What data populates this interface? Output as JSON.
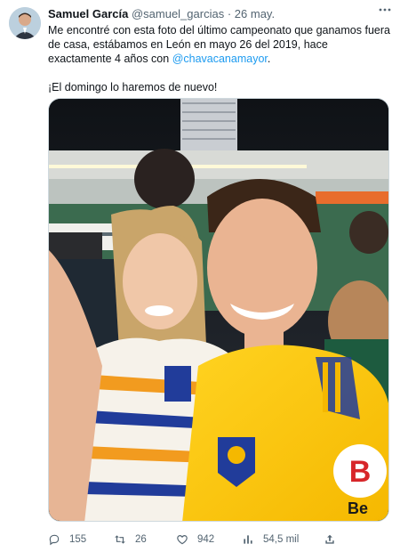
{
  "tweet": {
    "author": {
      "name": "Samuel García",
      "handle": "@samuel_garcias",
      "separator": "·",
      "date": "26 may."
    },
    "more_icon": "more-horizontal-icon",
    "text": {
      "line1_before": "Me encontré con esta foto del último campeonato que ganamos fuera de casa, estábamos en León en mayo 26 del 2019, hace exactamente 4 años con ",
      "mention": "@chavacanamayor",
      "line1_after": ".",
      "line2": "¡El domingo lo haremos de nuevo!"
    },
    "media": {
      "description_icon": "photo",
      "logo_text": "B",
      "logo_subtext": "Be"
    },
    "actions": {
      "replies": {
        "icon": "reply-icon",
        "count": "155"
      },
      "retweets": {
        "icon": "retweet-icon",
        "count": "26"
      },
      "likes": {
        "icon": "heart-icon",
        "count": "942"
      },
      "views": {
        "icon": "views-icon",
        "count": "54,5 mil"
      },
      "share": {
        "icon": "share-icon"
      }
    }
  }
}
